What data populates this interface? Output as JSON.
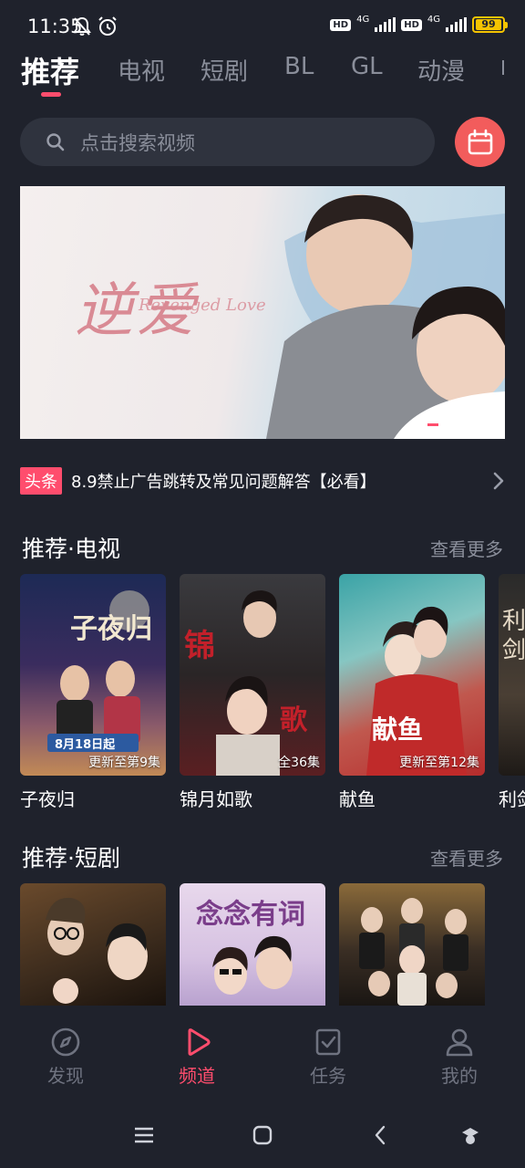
{
  "status": {
    "time": "11:35",
    "hd1": "HD",
    "net1": "4G",
    "hd2": "HD",
    "net2": "4G",
    "battery": "99",
    "icons": [
      "bell-off-icon",
      "alarm-icon"
    ]
  },
  "tabs": [
    {
      "label": "推荐",
      "active": true
    },
    {
      "label": "电视"
    },
    {
      "label": "短剧"
    },
    {
      "label": "BL"
    },
    {
      "label": "GL"
    },
    {
      "label": "动漫"
    }
  ],
  "search": {
    "placeholder": "点击搜索视频",
    "icon": "search-icon"
  },
  "calendar": {
    "icon": "calendar-icon",
    "color": "#f25c5c"
  },
  "banner": {
    "title": "逆爱",
    "subtitle": "Revenged Love",
    "slide_count": 4,
    "active_slide": 1
  },
  "headline": {
    "badge": "头条",
    "text": "8.9禁止广告跳转及常见问题解答【必看】"
  },
  "sections": {
    "tv": {
      "title": "推荐·电视",
      "more": "查看更多",
      "items": [
        {
          "title": "子夜归",
          "badge": "更新至第9集"
        },
        {
          "title": "锦月如歌",
          "badge": "全36集"
        },
        {
          "title": "献鱼",
          "badge": "更新至第12集"
        },
        {
          "title": "利剑"
        }
      ]
    },
    "short": {
      "title": "推荐·短剧",
      "more": "查看更多",
      "items": [
        {
          "title": ""
        },
        {
          "title": ""
        },
        {
          "title": ""
        }
      ]
    }
  },
  "bottom_nav": [
    {
      "label": "发现",
      "icon": "compass-icon"
    },
    {
      "label": "频道",
      "icon": "play-icon",
      "active": true
    },
    {
      "label": "任务",
      "icon": "task-icon"
    },
    {
      "label": "我的",
      "icon": "user-icon"
    }
  ],
  "colors": {
    "accent": "#ff4d6d",
    "background": "#1f222c",
    "search_bg": "#2f333e"
  }
}
